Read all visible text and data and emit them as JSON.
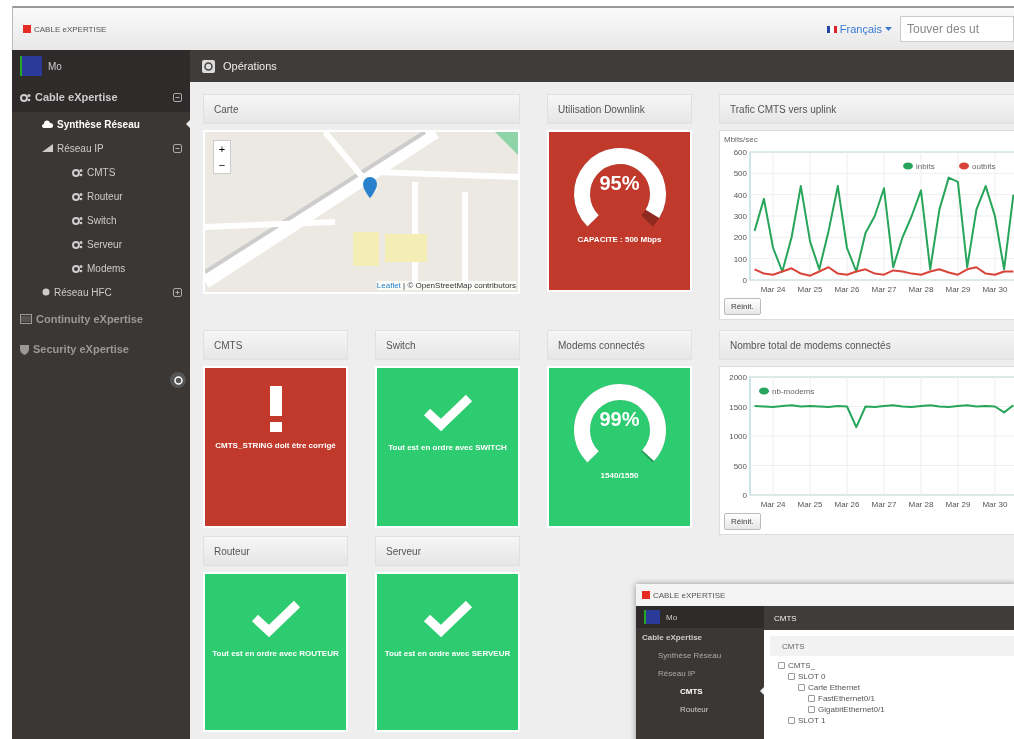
{
  "header": {
    "logo": "CABLE eXPERTISE",
    "language": "Français",
    "search": {
      "placeholder": "Touver des ut"
    }
  },
  "sidebar": {
    "user": "Mo",
    "items": [
      {
        "label": "Cable eXpertise",
        "expanded": true,
        "children": [
          {
            "label": "Synthèse Réseau",
            "selected": true
          },
          {
            "label": "Réseau IP",
            "selected": false,
            "expanded": true,
            "children": [
              {
                "label": "CMTS",
                "selected": false
              },
              {
                "label": "Routeur",
                "selected": false
              },
              {
                "label": "Switch",
                "selected": false
              },
              {
                "label": "Serveur",
                "selected": false
              },
              {
                "label": "Modems",
                "selected": false
              }
            ]
          },
          {
            "label": "Réseau HFC",
            "selected": false,
            "expanded": false
          }
        ]
      },
      {
        "label": "Continuity eXpertise",
        "expanded": false
      },
      {
        "label": "Security eXpertise",
        "expanded": false
      }
    ]
  },
  "page_title": "Opérations",
  "tiles": [
    {
      "kind": "map",
      "title": "Carte",
      "attribution_link": "Leaflet",
      "attribution": "| © OpenStreetMap contributors",
      "zoom_in": "+",
      "zoom_out": "−"
    },
    {
      "kind": "gauge",
      "title": "Utilisation Downlink",
      "alert": true,
      "value": "95%",
      "caption": "CAPACITE : 500 Mbps"
    },
    {
      "kind": "chart",
      "title": "Trafic CMTS vers uplink",
      "button": "Réinit.",
      "chart_data": {
        "type": "line",
        "grid": true,
        "legend": "top-right",
        "ylabel": "Mbits/sec",
        "categories": [
          null,
          null,
          "Mar 24",
          null,
          null,
          null,
          "Mar 25",
          null,
          null,
          null,
          "Mar 26",
          null,
          null,
          null,
          "Mar 27",
          null,
          null,
          null,
          "Mar 28",
          null,
          null,
          null,
          "Mar 29",
          null,
          null,
          null,
          "Mar 30",
          null,
          null
        ],
        "ylim": [
          0,
          600
        ],
        "yticks": [
          0,
          100,
          200,
          300,
          400,
          500,
          600
        ],
        "series": [
          {
            "name": "inbits",
            "color": "#27a55a",
            "values": [
              230,
              380,
              150,
              40,
              200,
              440,
              180,
              50,
              230,
              440,
              150,
              40,
              220,
              300,
              430,
              60,
              200,
              300,
              420,
              50,
              330,
              480,
              460,
              60,
              330,
              440,
              300,
              50,
              400
            ]
          },
          {
            "name": "outbits",
            "color": "#d9443a",
            "values": [
              50,
              30,
              25,
              40,
              55,
              30,
              20,
              40,
              60,
              30,
              25,
              40,
              50,
              30,
              25,
              45,
              40,
              30,
              25,
              40,
              50,
              35,
              25,
              50,
              60,
              30,
              25,
              40,
              40
            ]
          }
        ]
      }
    },
    {
      "kind": "status",
      "title": "CMTS",
      "alert": true,
      "message": "CMTS_STRING doit être corrigé"
    },
    {
      "kind": "status",
      "title": "Switch",
      "alert": false,
      "message": "Tout est en ordre avec SWITCH"
    },
    {
      "kind": "gauge",
      "title": "Modems connectés",
      "alert": false,
      "value": "99%",
      "caption": "1540/1550"
    },
    {
      "kind": "chart",
      "title": "Nombre total de modems connectés",
      "button": "Réinit.",
      "chart_data": {
        "type": "line",
        "grid": true,
        "legend": "top-left",
        "categories": [
          null,
          null,
          "Mar 24",
          null,
          null,
          null,
          "Mar 25",
          null,
          null,
          null,
          "Mar 26",
          null,
          null,
          null,
          "Mar 27",
          null,
          null,
          null,
          "Mar 28",
          null,
          null,
          null,
          "Mar 29",
          null,
          null,
          null,
          "Mar 30",
          null,
          null
        ],
        "ylim": [
          0,
          2000
        ],
        "yticks": [
          0,
          500,
          1000,
          1500,
          2000
        ],
        "series": [
          {
            "name": "nb-modems",
            "color": "#27a55a",
            "values": [
              1510,
              1500,
              1490,
              1510,
              1520,
              1500,
              1510,
              1500,
              1490,
              1510,
              1500,
              1150,
              1500,
              1490,
              1510,
              1520,
              1500,
              1490,
              1510,
              1520,
              1500,
              1490,
              1510,
              1520,
              1500,
              1510,
              1500,
              1400,
              1520
            ]
          }
        ]
      }
    },
    {
      "kind": "status",
      "title": "Routeur",
      "alert": false,
      "message": "Tout est en ordre avec ROUTEUR"
    },
    {
      "kind": "status",
      "title": "Serveur",
      "alert": false,
      "message": "Tout est en ordre avec SERVEUR"
    }
  ],
  "inset": {
    "logo": "CABLE eXPERTISE",
    "user": "Mo",
    "nav": [
      {
        "label": "Cable eXpertise",
        "kind": "top",
        "selected": false
      },
      {
        "label": "Synthèse Réseau",
        "kind": "sub",
        "selected": false
      },
      {
        "label": "Réseau IP",
        "kind": "sub",
        "selected": false
      },
      {
        "label": "CMTS",
        "kind": "leaf",
        "selected": true
      },
      {
        "label": "Routeur",
        "kind": "leaf",
        "selected": false
      }
    ],
    "page_title": "CMTS",
    "panel_title": "CMTS",
    "tree": [
      {
        "label": "CMTS_",
        "children": [
          {
            "label": "SLOT 0",
            "children": [
              {
                "label": "Carte Ethernet",
                "children": [
                  {
                    "label": "FastEthernet0/1"
                  },
                  {
                    "label": "GigabitEthernet0/1"
                  }
                ]
              }
            ]
          },
          {
            "label": "SLOT 1"
          }
        ]
      }
    ]
  }
}
